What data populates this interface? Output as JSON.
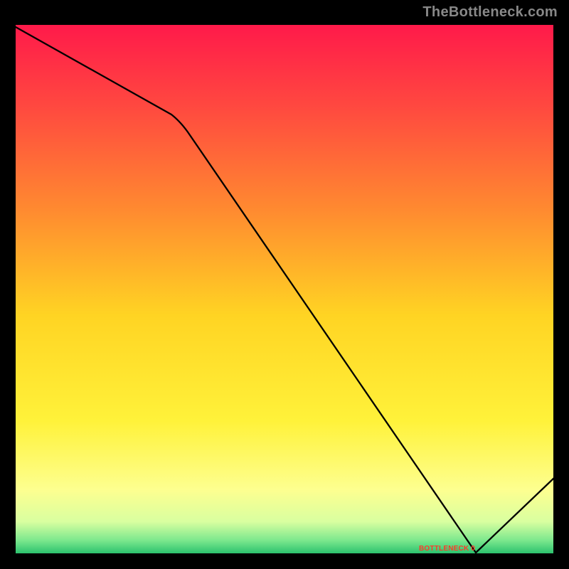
{
  "watermark": "TheBottleneck.com",
  "marker_label": "BOTTLENECK 0",
  "chart_data": {
    "type": "line",
    "title": "",
    "xlabel": "",
    "ylabel": "",
    "xlim": [
      0,
      100
    ],
    "ylim": [
      0,
      100
    ],
    "grid": false,
    "series": [
      {
        "name": "curve",
        "x": [
          0,
          30,
          85,
          100
        ],
        "y": [
          99,
          82,
          0,
          14
        ]
      }
    ],
    "marker": {
      "x": 78,
      "y": 0,
      "label": "BOTTLENECK 0"
    },
    "background_gradient": {
      "stops": [
        {
          "pos": 0.0,
          "color": "#ff1a4a"
        },
        {
          "pos": 0.15,
          "color": "#ff4740"
        },
        {
          "pos": 0.35,
          "color": "#ff8a30"
        },
        {
          "pos": 0.55,
          "color": "#ffd423"
        },
        {
          "pos": 0.75,
          "color": "#fff23a"
        },
        {
          "pos": 0.88,
          "color": "#fdff90"
        },
        {
          "pos": 0.94,
          "color": "#d9ffa0"
        },
        {
          "pos": 0.975,
          "color": "#7de88e"
        },
        {
          "pos": 1.0,
          "color": "#2cc26e"
        }
      ]
    }
  }
}
